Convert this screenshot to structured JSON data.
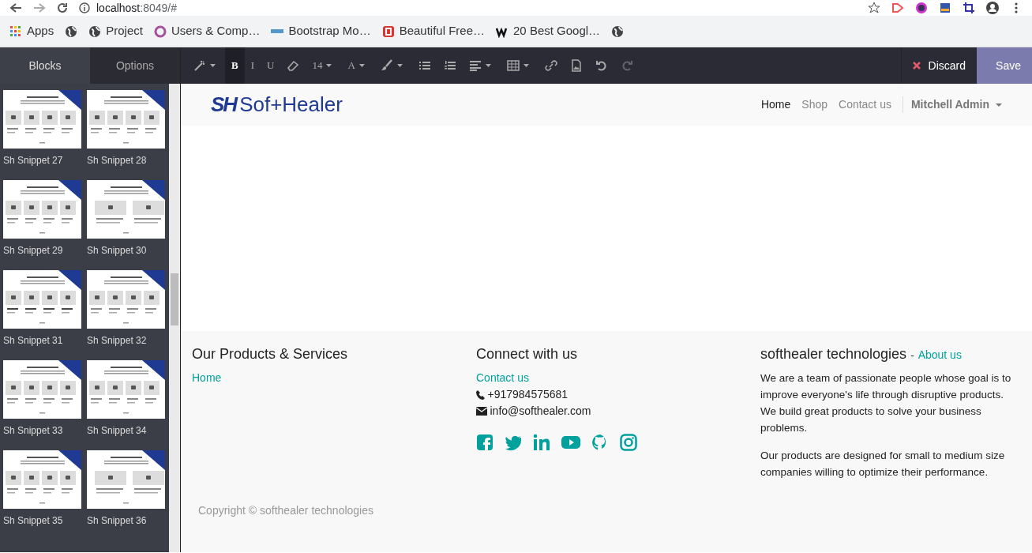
{
  "browser": {
    "address_host": "localhost",
    "address_rest": ":8049/#",
    "bookmarks": [
      {
        "kind": "apps",
        "label": "Apps"
      },
      {
        "kind": "globe"
      },
      {
        "kind": "globe",
        "label": "Project"
      },
      {
        "kind": "ring",
        "label": "Users & Comp…"
      },
      {
        "kind": "mdb",
        "label": "Bootstrap Mo…"
      },
      {
        "kind": "b",
        "label": "Beautiful Free…"
      },
      {
        "kind": "w",
        "label": "20 Best Googl…"
      },
      {
        "kind": "globe"
      }
    ]
  },
  "sidebar": {
    "tabs": [
      {
        "label": "Blocks",
        "selected": true
      },
      {
        "label": "Options",
        "selected": false
      }
    ],
    "snippets": [
      {
        "label": "Sh Snippet 27"
      },
      {
        "label": "Sh Snippet 28"
      },
      {
        "label": "Sh Snippet 29"
      },
      {
        "label": "Sh Snippet 30"
      },
      {
        "label": "Sh Snippet 31"
      },
      {
        "label": "Sh Snippet 32"
      },
      {
        "label": "Sh Snippet 33"
      },
      {
        "label": "Sh Snippet 34"
      },
      {
        "label": "Sh Snippet 35"
      },
      {
        "label": "Sh Snippet 36"
      }
    ]
  },
  "toolbar": {
    "tools": [
      {
        "kind": "wand",
        "caret": true,
        "selected": false,
        "disabled": false
      },
      {
        "kind": "text",
        "text": "B",
        "caret": false,
        "selected": true,
        "disabled": false
      },
      {
        "kind": "text",
        "text": "I",
        "caret": false,
        "selected": false,
        "disabled": false
      },
      {
        "kind": "text",
        "text": "U",
        "caret": false,
        "selected": false,
        "disabled": false
      },
      {
        "kind": "eraser",
        "caret": false,
        "selected": false,
        "disabled": false
      },
      {
        "kind": "text",
        "text": "14",
        "caret": true,
        "selected": false,
        "disabled": false
      },
      {
        "kind": "text",
        "text": "A",
        "caret": true,
        "selected": false,
        "disabled": false
      },
      {
        "kind": "brush",
        "caret": true,
        "selected": false,
        "disabled": false
      },
      {
        "kind": "ul",
        "caret": false,
        "selected": false,
        "disabled": false
      },
      {
        "kind": "ol",
        "caret": false,
        "selected": false,
        "disabled": false
      },
      {
        "kind": "align",
        "caret": true,
        "selected": false,
        "disabled": false
      },
      {
        "kind": "table",
        "caret": true,
        "selected": false,
        "disabled": false
      },
      {
        "kind": "link",
        "caret": false,
        "selected": false,
        "disabled": false
      },
      {
        "kind": "image",
        "caret": false,
        "selected": false,
        "disabled": false
      },
      {
        "kind": "undo",
        "caret": false,
        "selected": false,
        "disabled": false
      },
      {
        "kind": "redo",
        "caret": false,
        "selected": false,
        "disabled": true
      }
    ],
    "discard": "Discard",
    "save": "Save"
  },
  "site": {
    "logo_mark": "SH",
    "logo_text": "Sof+Healer",
    "nav": [
      {
        "label": "Home",
        "selected": true
      },
      {
        "label": "Shop",
        "selected": false
      },
      {
        "label": "Contact us",
        "selected": false
      }
    ],
    "user": "Mitchell Admin"
  },
  "footer": {
    "col1": {
      "title": "Our Products & Services",
      "links": [
        "Home"
      ]
    },
    "col2": {
      "title": "Connect with us",
      "link": "Contact us",
      "phone": "+917984575681",
      "email": "info@softhealer.com",
      "social": [
        {
          "kind": "facebook"
        },
        {
          "kind": "twitter"
        },
        {
          "kind": "linkedin"
        },
        {
          "kind": "youtube"
        },
        {
          "kind": "github"
        },
        {
          "kind": "instagram"
        }
      ]
    },
    "col3": {
      "title": "softhealer technologies",
      "sep": "-",
      "link": "About us",
      "paragraphs": [
        "We are a team of passionate people whose goal is to improve everyone's life through disruptive products. We build great products to solve your business problems.",
        "Our products are designed for small to medium size companies willing to optimize their performance."
      ]
    },
    "copyright": "Copyright © softhealer technologies"
  }
}
